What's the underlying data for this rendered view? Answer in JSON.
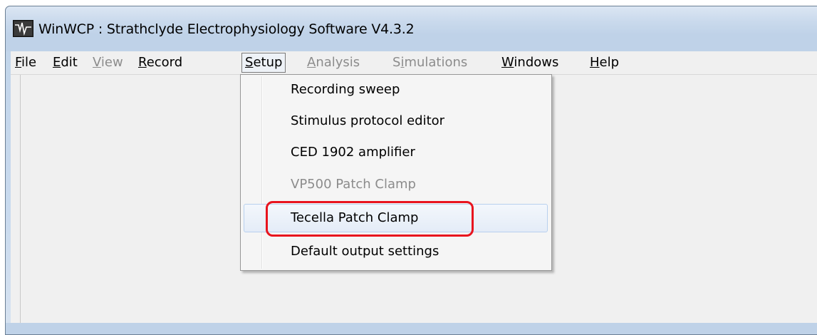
{
  "window": {
    "title": "WinWCP : Strathclyde Electrophysiology Software V4.3.2",
    "icon": "waveform-app-icon"
  },
  "menubar": {
    "items": [
      {
        "label": "File",
        "underline": "F",
        "rest": "ile",
        "enabled": true
      },
      {
        "label": "Edit",
        "underline": "E",
        "rest": "dit",
        "enabled": true
      },
      {
        "label": "View",
        "underline": "V",
        "rest": "iew",
        "enabled": false
      },
      {
        "label": "Record",
        "underline": "R",
        "rest": "ecord",
        "enabled": true
      },
      {
        "label": "Setup",
        "underline": "S",
        "rest": "etup",
        "enabled": true,
        "open": true
      },
      {
        "label": "Analysis",
        "underline": "A",
        "rest": "nalysis",
        "enabled": false
      },
      {
        "label": "Simulations",
        "pre": "S",
        "underline": "i",
        "rest": "mulations",
        "enabled": false
      },
      {
        "label": "Windows",
        "underline": "W",
        "rest": "indows",
        "enabled": true
      },
      {
        "label": "Help",
        "underline": "H",
        "rest": "elp",
        "enabled": true
      }
    ]
  },
  "setup_menu": {
    "items": [
      {
        "label": "Recording sweep",
        "enabled": true
      },
      {
        "label": "Stimulus protocol editor",
        "enabled": true
      },
      {
        "label": "CED 1902 amplifier",
        "enabled": true
      },
      {
        "label": "VP500 Patch Clamp",
        "enabled": false
      },
      {
        "label": "Tecella Patch Clamp",
        "enabled": true,
        "hovered": true
      },
      {
        "label": "Default output settings",
        "enabled": true
      }
    ]
  },
  "colors": {
    "highlight": "#e8141e",
    "disabled_text": "#8c8c8c",
    "title_bar": "#c9d9ec"
  }
}
